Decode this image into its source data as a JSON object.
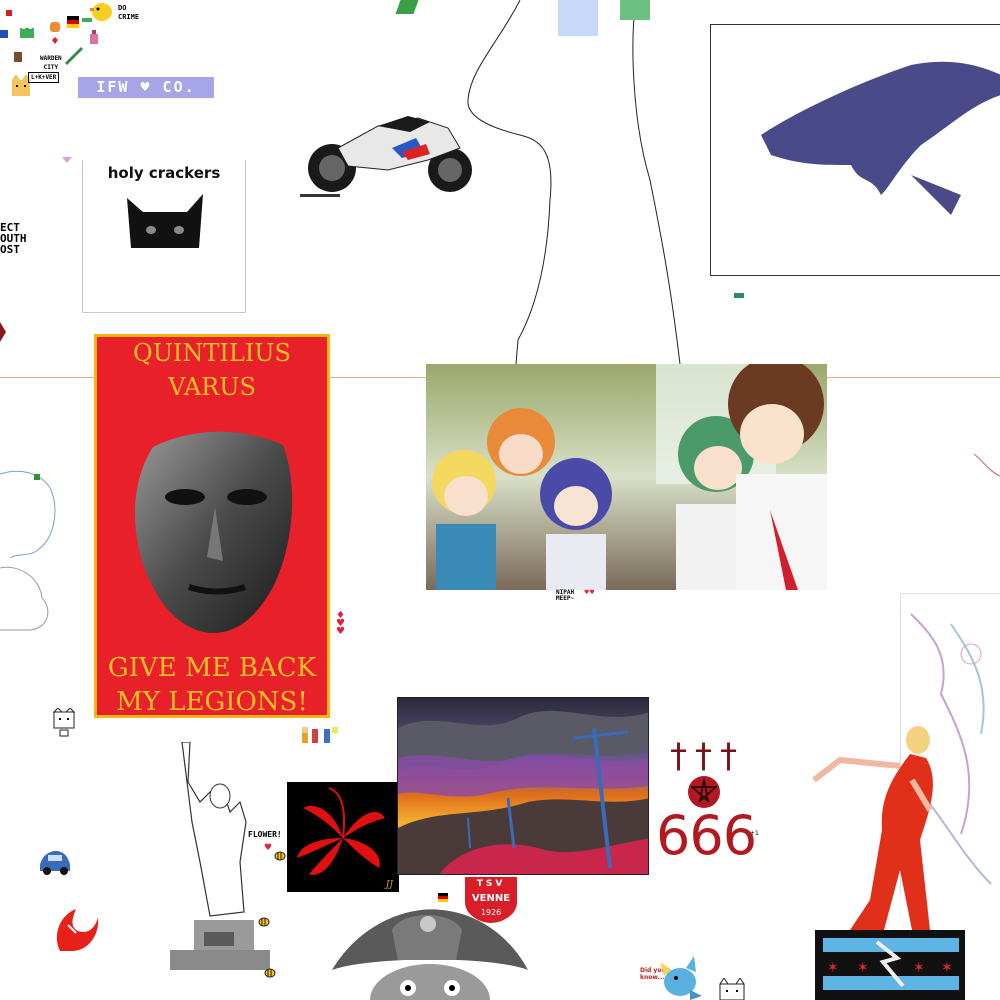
{
  "colors": {
    "background": "#ffffff",
    "guide_line": "#e0b070",
    "varus_red": "#e8202a",
    "varus_gold": "#f5c026",
    "varus_border": "#f2b511",
    "map_blue": "#4a4a8a",
    "ifw_bg": "#a5a5e8",
    "six_red": "#b01a20",
    "chicago_blue": "#5fb4e6",
    "chicago_star": "#e8252b"
  },
  "top_left": {
    "do_crime": "DO\nCRIME",
    "warden_city": "WARDEN\nCITY",
    "ifw_banner": "IFW ♥ CO.",
    "lock_label": "L+K+VER"
  },
  "holy_crackers": {
    "label": "holy crackers"
  },
  "left_edge_text": {
    "text": "ECT\nOUTH\nOST"
  },
  "varus_poster": {
    "line1": "QUINTILIUS",
    "line2": "VARUS",
    "line3": "GIVE ME BACK",
    "line4": "MY LEGIONS!"
  },
  "anime_caption": {
    "line1": "NIPAH",
    "line2": "MEEP~",
    "hearts": "♥♥"
  },
  "flower_label": {
    "text": "FLOWER!"
  },
  "lily_signature": {
    "text": "JJ"
  },
  "six_six_six": {
    "text": "666",
    "crosses": "†††",
    "note": "+1"
  },
  "tsv_badge": {
    "top": "TSV",
    "name": "VENNE",
    "year": "1926"
  },
  "did_you_know": {
    "text": "Did you\nknow..."
  },
  "icons": [
    "motorcycle-icon",
    "cat-icon",
    "duck-icon",
    "bee-icon",
    "car-icon",
    "cat-face-icon",
    "pentagram-icon",
    "swan-icon",
    "germany-flag-icon",
    "heart-icon",
    "sword-icon",
    "potion-icon"
  ]
}
